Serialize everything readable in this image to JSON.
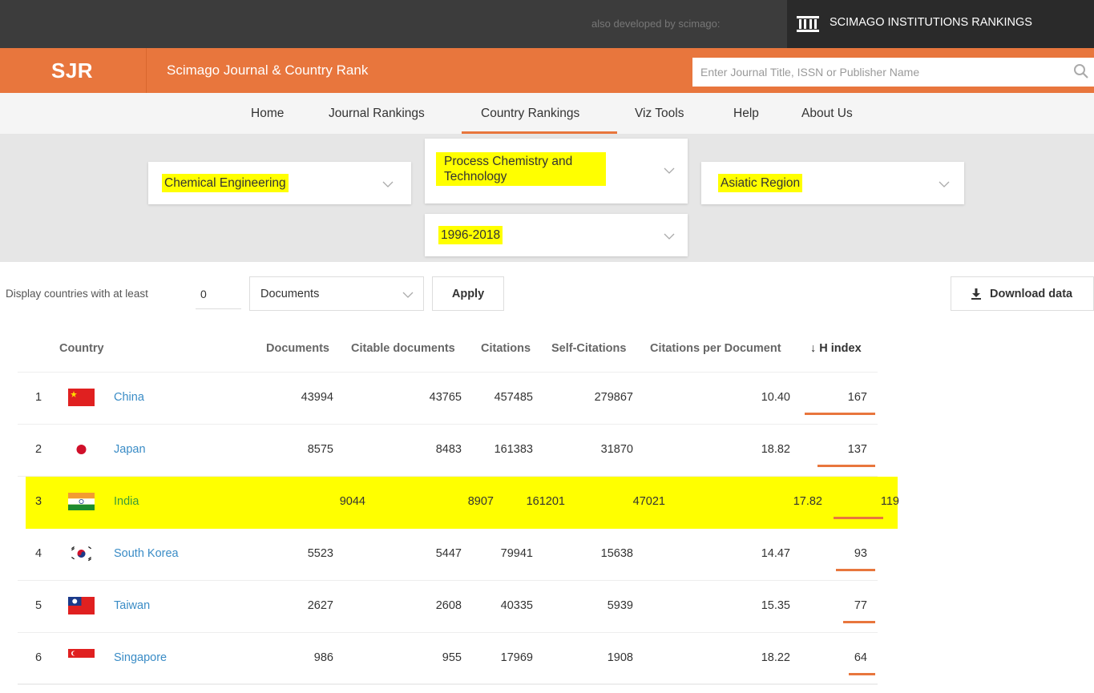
{
  "topbar": {
    "also_developed": "also developed by scimago:",
    "institutions_link": "SCIMAGO INSTITUTIONS RANKINGS"
  },
  "header": {
    "logo": "SJR",
    "site_title": "Scimago Journal & Country Rank",
    "search_placeholder": "Enter Journal Title, ISSN or Publisher Name"
  },
  "nav": {
    "items": [
      "Home",
      "Journal Rankings",
      "Country Rankings",
      "Viz Tools",
      "Help",
      "About Us"
    ],
    "active": "Country Rankings"
  },
  "filters": {
    "area": "Chemical Engineering",
    "category_line1": "Process Chemistry and",
    "category_line2": "Technology",
    "region": "Asiatic Region",
    "years": "1996-2018"
  },
  "display": {
    "label": "Display countries with at least",
    "min_value": "0",
    "metric": "Documents",
    "apply_label": "Apply",
    "download_label": "Download data"
  },
  "table": {
    "columns": [
      "Country",
      "Documents",
      "Citable documents",
      "Citations",
      "Self-Citations",
      "Citations per Document",
      "↓ H index"
    ],
    "rows": [
      {
        "rank": "1",
        "country": "China",
        "flag": "china-flag",
        "documents": "43994",
        "citable": "43765",
        "citations": "457485",
        "self_citations": "279867",
        "cpd": "10.40",
        "h_index": "167",
        "h_fraction": 1.0
      },
      {
        "rank": "2",
        "country": "Japan",
        "flag": "japan-flag",
        "documents": "8575",
        "citable": "8483",
        "citations": "161383",
        "self_citations": "31870",
        "cpd": "18.82",
        "h_index": "137",
        "h_fraction": 0.82
      },
      {
        "rank": "3",
        "country": "India",
        "flag": "india-flag",
        "documents": "9044",
        "citable": "8907",
        "citations": "161201",
        "self_citations": "47021",
        "cpd": "17.82",
        "h_index": "119",
        "h_fraction": 0.71,
        "highlighted": true
      },
      {
        "rank": "4",
        "country": "South Korea",
        "flag": "south-korea-flag",
        "documents": "5523",
        "citable": "5447",
        "citations": "79941",
        "self_citations": "15638",
        "cpd": "14.47",
        "h_index": "93",
        "h_fraction": 0.56
      },
      {
        "rank": "5",
        "country": "Taiwan",
        "flag": "taiwan-flag",
        "documents": "2627",
        "citable": "2608",
        "citations": "40335",
        "self_citations": "5939",
        "cpd": "15.35",
        "h_index": "77",
        "h_fraction": 0.46
      },
      {
        "rank": "6",
        "country": "Singapore",
        "flag": "singapore-flag",
        "documents": "986",
        "citable": "955",
        "citations": "17969",
        "self_citations": "1908",
        "cpd": "18.22",
        "h_index": "64",
        "h_fraction": 0.38
      }
    ]
  },
  "colors": {
    "accent": "#e8763d",
    "highlight": "#ffff00",
    "link": "#3a8cc6",
    "dark_bar": "#3c3c3c"
  }
}
